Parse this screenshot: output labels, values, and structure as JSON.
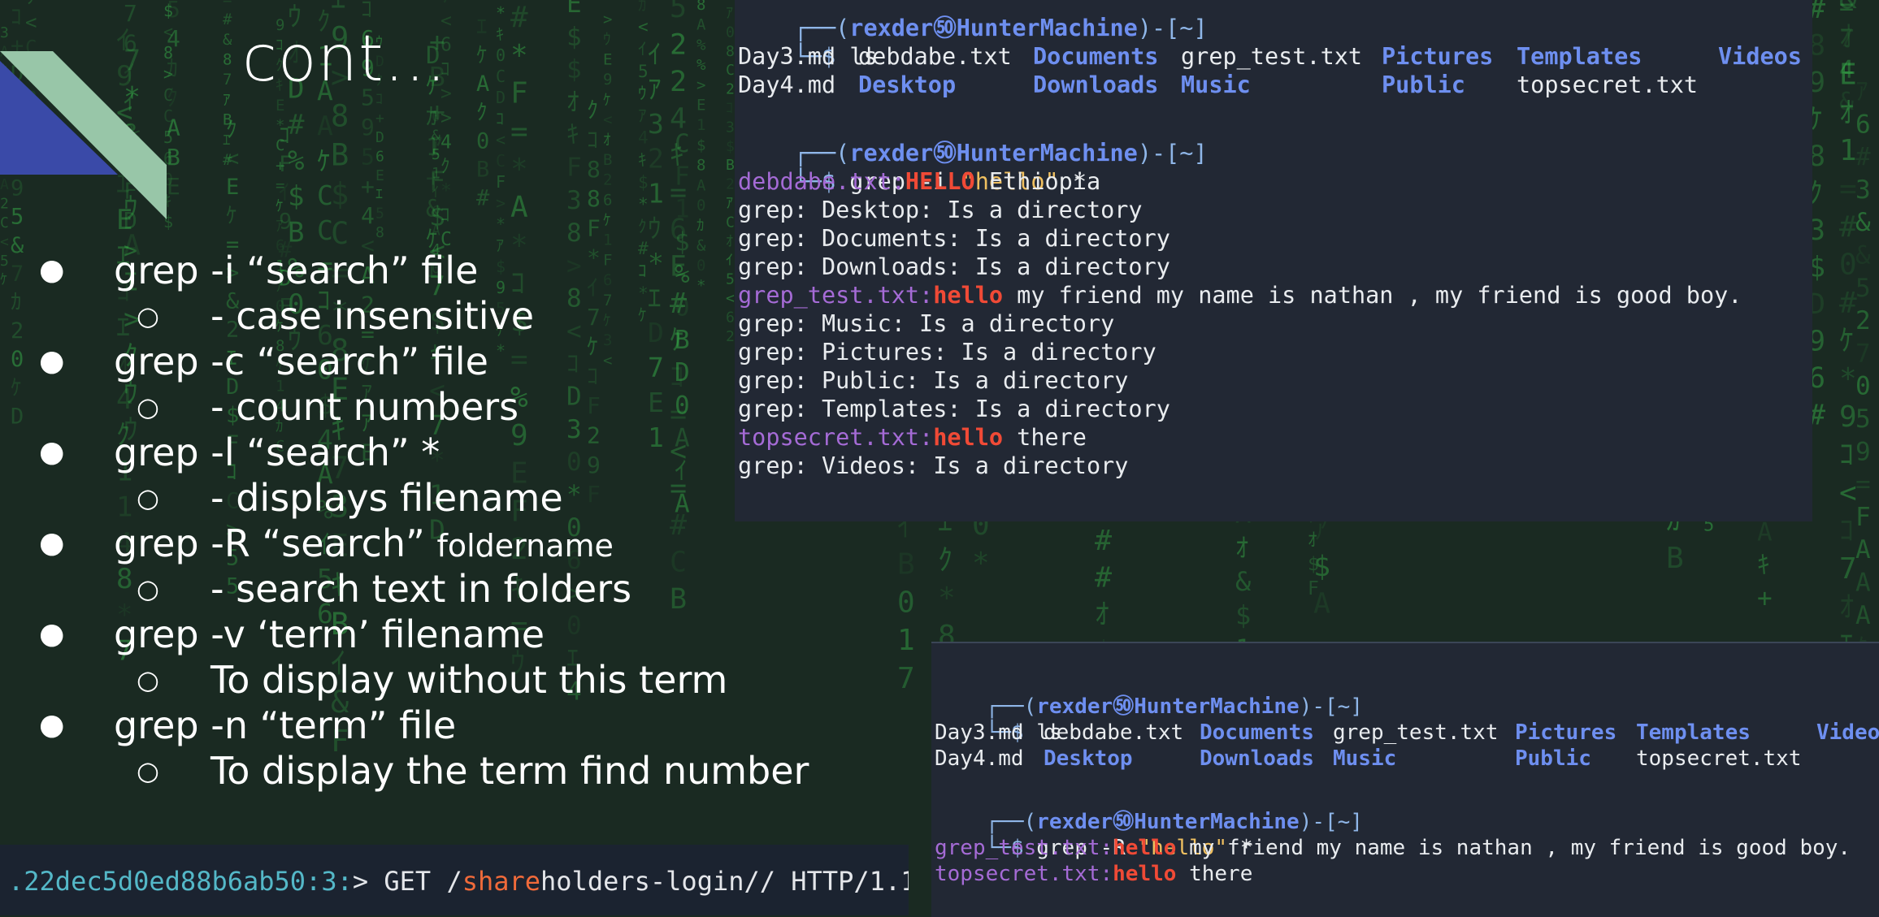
{
  "slide": {
    "title": "cont...",
    "bullets": [
      {
        "level": 1,
        "text": "grep -i “search” file",
        "suffix": ""
      },
      {
        "level": 2,
        "text": "- case insensitive",
        "suffix": ""
      },
      {
        "level": 1,
        "text": "grep -c “search” file",
        "suffix": ""
      },
      {
        "level": 2,
        "text": "- count numbers",
        "suffix": ""
      },
      {
        "level": 1,
        "text": "grep -l “search” *",
        "suffix": ""
      },
      {
        "level": 2,
        "text": "-  displays filename",
        "suffix": ""
      },
      {
        "level": 1,
        "text": "grep -R “search” ",
        "suffix": "foldername"
      },
      {
        "level": 2,
        "text": "- search text in folders",
        "suffix": ""
      },
      {
        "level": 1,
        "text": "grep -v ‘term’ filename",
        "suffix": ""
      },
      {
        "level": 2,
        "text": "To display without this term",
        "suffix": ""
      },
      {
        "level": 1,
        "text": "grep -n “term” file",
        "suffix": ""
      },
      {
        "level": 2,
        "text": "To display the term find number",
        "suffix": ""
      }
    ],
    "bullet_glyph_l1": "●",
    "bullet_glyph_l2": "○"
  },
  "terminal1": {
    "prompt_open": "┌──(",
    "user": "rexder",
    "at_icon": "㊿",
    "host": "HunterMachine",
    "prompt_close": ")-[~]",
    "prompt_cmd_prefix": "└─$ ",
    "cmd_ls": "ls",
    "ls_row1": [
      "Day3.md",
      "debdabe.txt",
      "Documents",
      "grep_test.txt",
      "Pictures",
      "Templates",
      "Videos"
    ],
    "ls_row2": [
      "Day4.md",
      "Desktop",
      "Downloads",
      "Music",
      "Public",
      "topsecret.txt"
    ],
    "cmd_grep": "grep -i ",
    "cmd_grep_arg": "\"hello\"",
    "cmd_grep_tail": " *",
    "out": [
      {
        "file": "debdabe.txt:",
        "match": "HELLO",
        "rest": " Ethiopia"
      },
      {
        "plain": "grep: Desktop: Is a directory"
      },
      {
        "plain": "grep: Documents: Is a directory"
      },
      {
        "plain": "grep: Downloads: Is a directory"
      },
      {
        "file": "grep_test.txt:",
        "match": "hello",
        "rest": " my friend my name is nathan , my friend is good boy."
      },
      {
        "plain": "grep: Music: Is a directory"
      },
      {
        "plain": "grep: Pictures: Is a directory"
      },
      {
        "plain": "grep: Public: Is a directory"
      },
      {
        "plain": "grep: Templates: Is a directory"
      },
      {
        "file": "topsecret.txt:",
        "match": "hello",
        "rest": " there"
      },
      {
        "plain": "grep: Videos: Is a directory"
      }
    ]
  },
  "terminal2": {
    "ls_row1": [
      "Day3.md",
      "debdabe.txt",
      "Documents",
      "grep_test.txt",
      "Pictures",
      "Templates",
      "Video"
    ],
    "ls_row2": [
      "Day4.md",
      "Desktop",
      "Downloads",
      "Music",
      "Public",
      "topsecret.txt"
    ],
    "cmd_grep": "grep -R ",
    "cmd_grep_arg": "\"hello\"",
    "cmd_grep_tail": " *",
    "out": [
      {
        "file": "grep_test.txt:",
        "match": "hello",
        "rest": " my friend my name is nathan , my friend is good boy."
      },
      {
        "file": "topsecret.txt:",
        "match": "hello",
        "rest": " there"
      }
    ]
  },
  "bottom_strip": {
    "hash": ".22dec5d0ed88b6ab50",
    "sep": ":3:",
    "req_a": "> GET /",
    "req_b": "share",
    "req_c": "holders-login// HTTP/1.1"
  },
  "colors": {
    "accent_teal": "#98c6a8",
    "accent_blue": "#3a4aa8",
    "matrix_green": "#2fbf3a"
  }
}
